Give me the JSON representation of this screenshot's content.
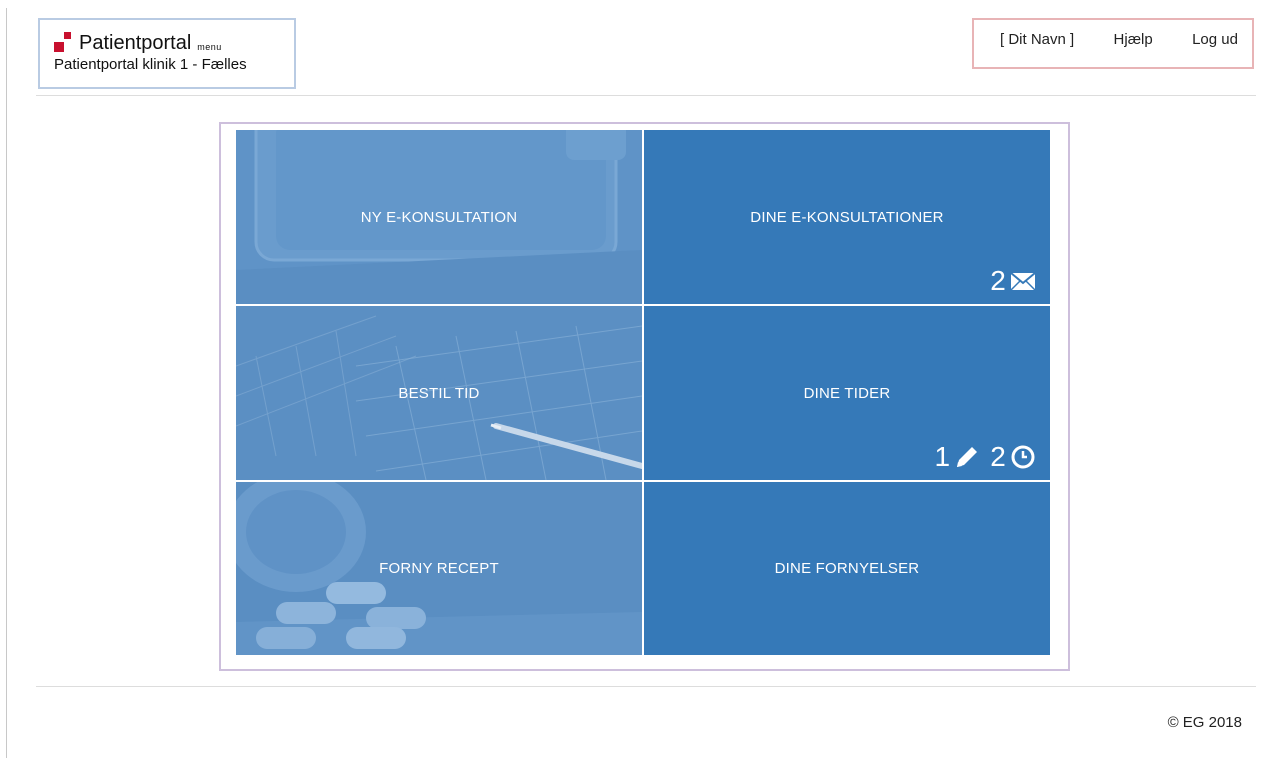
{
  "header": {
    "brand_title": "Patientportal",
    "menu_label": "menu",
    "clinic_name": "Patientportal klinik 1 - Fælles",
    "user_name": "[ Dit Navn ]",
    "help_label": "Hjælp",
    "logout_label": "Log ud"
  },
  "tiles": {
    "new_consultation": {
      "label": "NY E-KONSULTATION"
    },
    "your_consultations": {
      "label": "DINE E-KONSULTATIONER",
      "message_count": "2"
    },
    "book_time": {
      "label": "BESTIL TID"
    },
    "your_times": {
      "label": "DINE TIDER",
      "edit_count": "1",
      "time_count": "2"
    },
    "renew_prescription": {
      "label": "FORNY RECEPT"
    },
    "your_renewals": {
      "label": "DINE FORNYELSER"
    }
  },
  "footer": {
    "copyright": "© EG 2018"
  },
  "colors": {
    "tile_blue": "#3579b8",
    "tile_photo_blue": "#5a8fc4",
    "logo_red": "#c8102e"
  }
}
